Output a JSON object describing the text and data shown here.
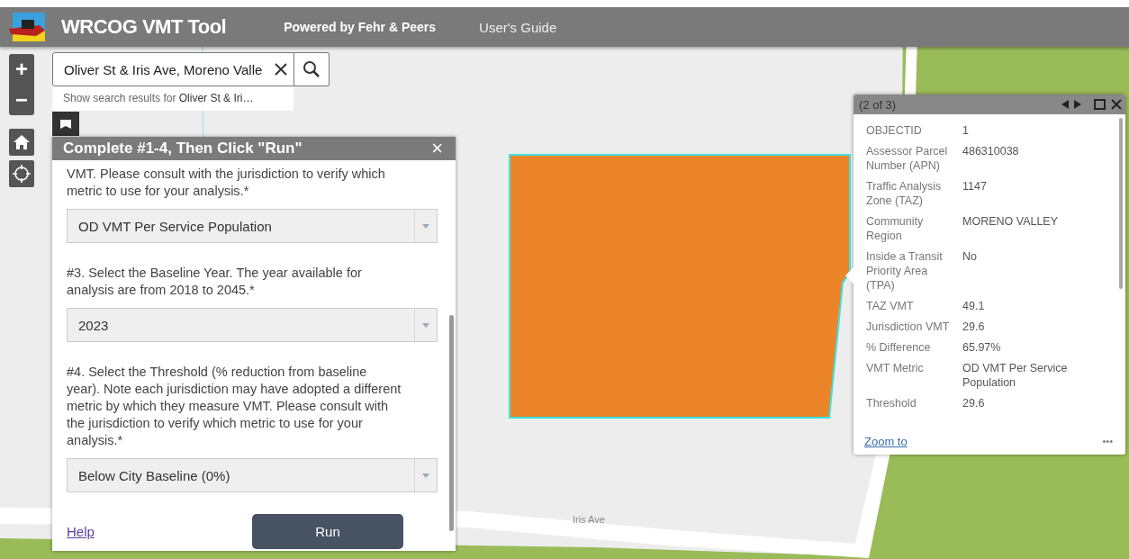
{
  "header": {
    "title": "WRCOG VMT Tool",
    "links": [
      "Powered by Fehr & Peers",
      "User's Guide"
    ]
  },
  "map_controls": {
    "zoom_in": "+",
    "zoom_out": "−"
  },
  "search": {
    "value": "Oliver St & Iris Ave, Moreno Valle",
    "suggestion_prefix": "Show search results for ",
    "suggestion_term": "Oliver St & Iri…"
  },
  "map": {
    "road_label": "Iris Ave"
  },
  "panel": {
    "title": "Complete #1-4, Then Click \"Run\"",
    "close": "×",
    "sections": [
      {
        "prompt": "VMT. Please consult with the jurisdiction to verify which metric to use for your analysis.*",
        "value": "OD VMT Per Service Population"
      },
      {
        "prompt": "#3. Select the Baseline Year. The year available for analysis are from 2018 to 2045.*",
        "value": "2023"
      },
      {
        "prompt": "#4. Select the Threshold (% reduction from baseline year). Note each jurisdiction may have adopted a different metric by which they measure VMT. Please consult with the jurisdiction to verify which metric to use for your analysis.*",
        "value": "Below City Baseline (0%)"
      }
    ],
    "help": "Help",
    "run": "Run"
  },
  "popup": {
    "counter": "(2 of 3)",
    "fields": [
      {
        "label": "OBJECTID",
        "value": "1"
      },
      {
        "label": "Assessor Parcel Number (APN)",
        "value": "486310038"
      },
      {
        "label": "Traffic Analysis Zone (TAZ)",
        "value": "1147"
      },
      {
        "label": "Community Region",
        "value": "MORENO VALLEY"
      },
      {
        "label": "Inside a Transit Priority Area (TPA)",
        "value": "No"
      },
      {
        "label": "TAZ VMT",
        "value": "49.1"
      },
      {
        "label": "Jurisdiction VMT",
        "value": "29.6"
      },
      {
        "label": "% Difference",
        "value": "65.97%"
      },
      {
        "label": "VMT Metric",
        "value": "OD VMT Per Service Population"
      },
      {
        "label": "Threshold",
        "value": "29.6"
      }
    ],
    "zoom_to": "Zoom to",
    "more": "•••"
  }
}
